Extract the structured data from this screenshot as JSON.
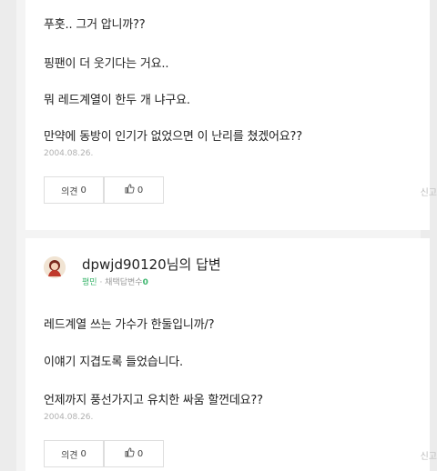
{
  "answer1": {
    "lines": [
      "푸훗.. 그거 압니까??",
      "핑팬이 더 웃기다는 거요..",
      "뭐 레드계열이 한두 개 냐구요.",
      "만약에 동방이 인기가 없었으면 이 난리를 쳤겠어요??"
    ],
    "date": "2004.08.26.",
    "opinion_label": "의견",
    "opinion_count": "0",
    "like_count": "0",
    "report_label": "신고"
  },
  "answer2": {
    "username": "dpwjd90120",
    "username_suffix": "님의 답변",
    "grade": "평민",
    "adopted_label": "채택답변수",
    "adopted_count": "0",
    "lines": [
      "레드계열 쓰는 가수가 한둘입니까/?",
      "이얘기 지겹도록 들었습니다.",
      "언제까지 풍선가지고 유치한 싸움 할껀데요??"
    ],
    "date": "2004.08.26.",
    "opinion_label": "의견",
    "opinion_count": "0",
    "like_count": "0",
    "report_label": "신고"
  },
  "icons": {
    "like": "thumbs-up-icon",
    "avatar": "user-avatar"
  },
  "colors": {
    "grade": "#3cb56d",
    "date": "#b0b0b0",
    "border": "#dedede"
  }
}
